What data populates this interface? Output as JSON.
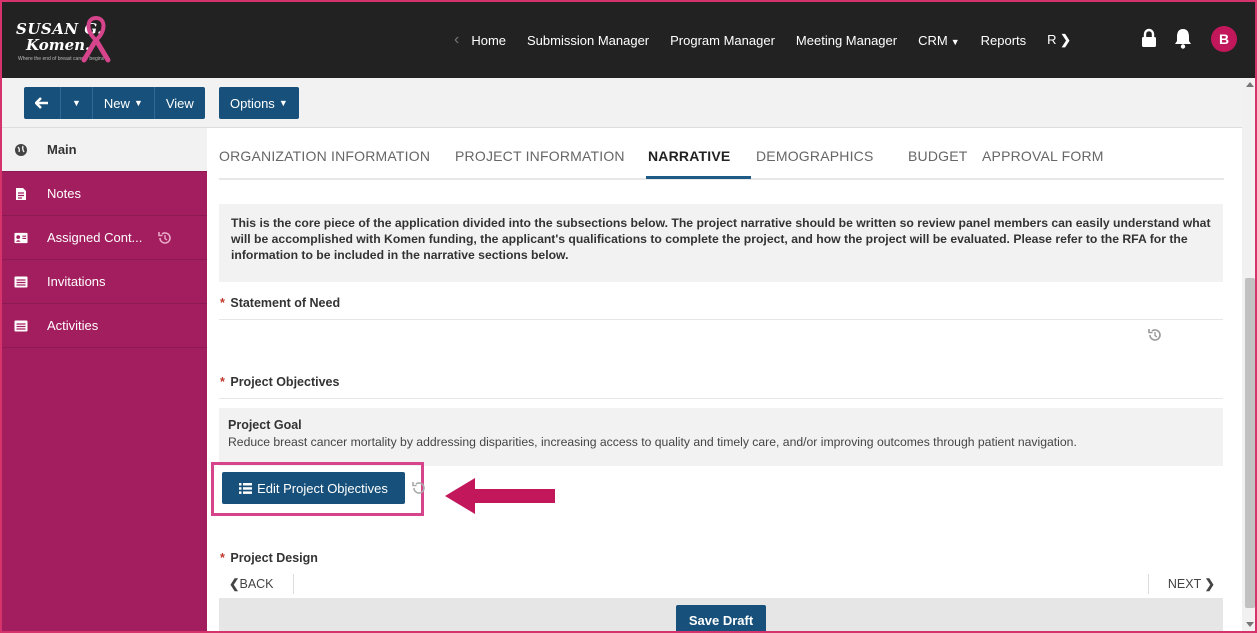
{
  "brand": {
    "logo_line1": "SUSAN G.",
    "logo_line2": "Komen.",
    "logo_tagline": "Where the end of breast cancer begins"
  },
  "colors": {
    "accent": "#a31e5e",
    "primary_button": "#17507a",
    "highlight": "#d6448c",
    "topbar": "#222222"
  },
  "topnav": {
    "items": [
      {
        "label": "Home"
      },
      {
        "label": "Submission Manager"
      },
      {
        "label": "Program Manager"
      },
      {
        "label": "Meeting Manager"
      },
      {
        "label": "CRM"
      },
      {
        "label": "Reports"
      },
      {
        "label": "R"
      }
    ],
    "avatar_initial": "B"
  },
  "toolbar": {
    "new_label": "New",
    "view_label": "View",
    "options_label": "Options"
  },
  "sidebar": {
    "items": [
      {
        "label": "Main"
      },
      {
        "label": "Notes"
      },
      {
        "label": "Assigned Cont..."
      },
      {
        "label": "Invitations"
      },
      {
        "label": "Activities"
      }
    ]
  },
  "tabs": [
    {
      "label": "ORGANIZATION INFORMATION"
    },
    {
      "label": "PROJECT INFORMATION"
    },
    {
      "label": "NARRATIVE"
    },
    {
      "label": "DEMOGRAPHICS"
    },
    {
      "label": "BUDGET"
    },
    {
      "label": "APPROVAL FORM"
    }
  ],
  "narrative": {
    "intro": "This is the core piece of the application divided into the subsections below. The project narrative should be written so review panel members can easily understand what will be accomplished with Komen funding, the applicant's qualifications to complete the project, and how the project will be evaluated. Please refer to the RFA for the information to be included in the narrative sections below.",
    "required_mark": "*",
    "statement_of_need_label": "Statement of Need",
    "project_objectives_label": "Project Objectives",
    "project_goal_title": "Project Goal",
    "project_goal_text": "Reduce breast cancer mortality by addressing disparities, increasing access to quality and timely care, and/or improving outcomes through patient navigation.",
    "edit_objectives_label": "Edit Project Objectives",
    "project_design_label": "Project Design",
    "back_label": "BACK",
    "next_label": "NEXT",
    "save_draft_label": "Save Draft"
  }
}
